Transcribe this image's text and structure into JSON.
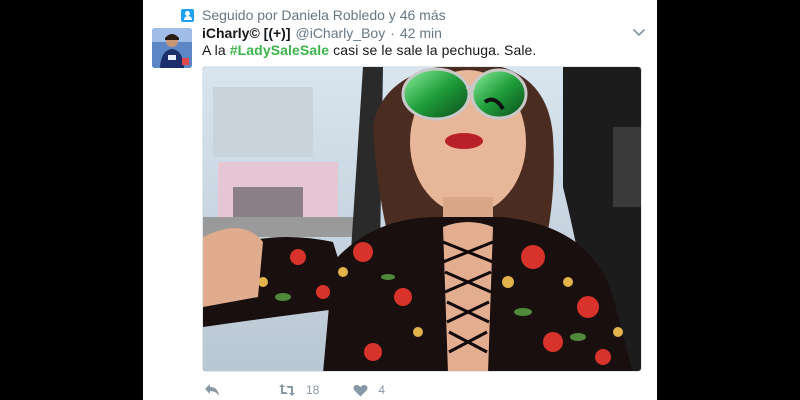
{
  "context": {
    "icon": "follow-user-icon",
    "text": "Seguido por Daniela Robledo y 46 más"
  },
  "author": {
    "display_name": "iCharly© [(+)]",
    "handle": "@iCharly_Boy",
    "separator": "·",
    "timestamp": "42 min"
  },
  "tweet": {
    "text_before": "A la ",
    "hashtag": "#LadySaleSale",
    "text_after": " casi se le sale la pechuga. Sale."
  },
  "media": {
    "type": "video-still",
    "description_icon": "embedded-media"
  },
  "actions": {
    "reply": {
      "icon": "reply-icon"
    },
    "retweet": {
      "icon": "retweet-icon",
      "count": "18"
    },
    "like": {
      "icon": "heart-icon",
      "count": "4"
    }
  },
  "colors": {
    "accent": "#1da1f2",
    "hashtag": "#3cb54a",
    "muted": "#657786",
    "icon": "#8899a6"
  }
}
